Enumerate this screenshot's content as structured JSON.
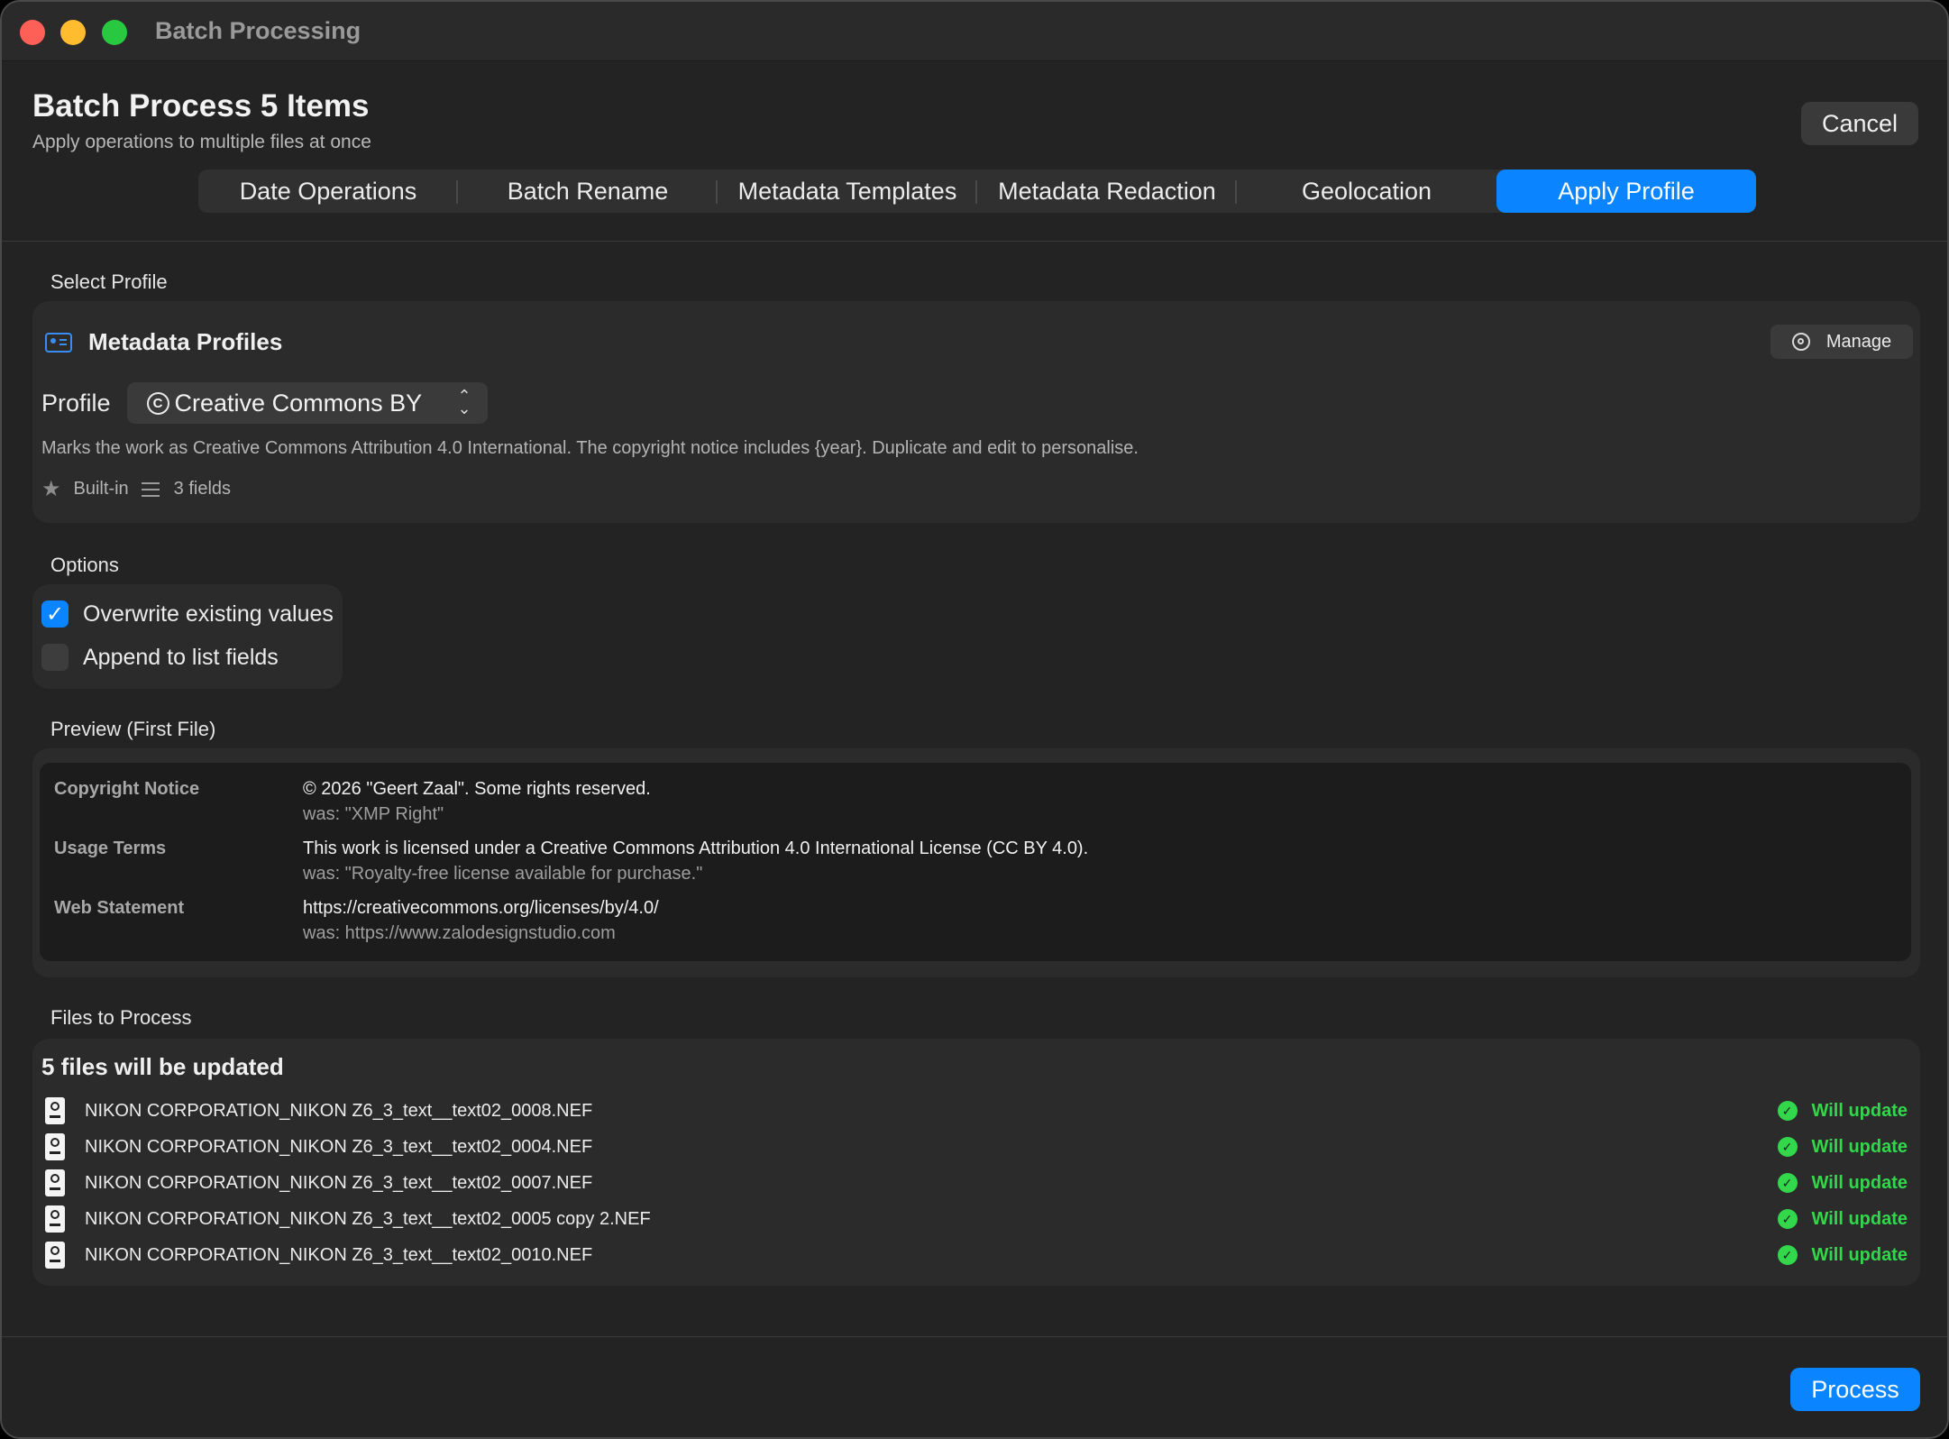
{
  "window": {
    "title": "Batch Processing"
  },
  "header": {
    "title": "Batch Process 5 Items",
    "subtitle": "Apply operations to multiple files at once",
    "cancel_label": "Cancel"
  },
  "tabs": [
    {
      "label": "Date Operations",
      "active": false
    },
    {
      "label": "Batch Rename",
      "active": false
    },
    {
      "label": "Metadata Templates",
      "active": false
    },
    {
      "label": "Metadata Redaction",
      "active": false
    },
    {
      "label": "Geolocation",
      "active": false
    },
    {
      "label": "Apply Profile",
      "active": true
    }
  ],
  "select_profile": {
    "section_label": "Select Profile",
    "card_title": "Metadata Profiles",
    "manage_label": "Manage",
    "profile_label": "Profile",
    "selected_profile": "Creative Commons BY",
    "cc_symbol": "C",
    "description": "Marks the work as Creative Commons Attribution 4.0 International. The copyright notice includes {year}. Duplicate and edit to personalise.",
    "badge_builtin": "Built-in",
    "fields_count": "3 fields"
  },
  "options": {
    "section_label": "Options",
    "items": [
      {
        "label": "Overwrite existing values",
        "checked": true
      },
      {
        "label": "Append to list fields",
        "checked": false
      }
    ]
  },
  "preview": {
    "section_label": "Preview (First File)",
    "rows": [
      {
        "field": "Copyright Notice",
        "new_value": "© 2026 \"Geert Zaal\". Some rights reserved.",
        "old_value": "was: \"XMP Right\""
      },
      {
        "field": "Usage Terms",
        "new_value": "This work is licensed under a Creative Commons Attribution 4.0 International License (CC BY 4.0).",
        "old_value": "was: \"Royalty-free license available for purchase.\""
      },
      {
        "field": "Web Statement",
        "new_value": "https://creativecommons.org/licenses/by/4.0/",
        "old_value": "was: https://www.zalodesignstudio.com"
      }
    ]
  },
  "files": {
    "section_label": "Files to Process",
    "summary": "5 files will be updated",
    "items": [
      {
        "name": "NIKON CORPORATION_NIKON Z6_3_text__text02_0008.NEF",
        "status": "Will update"
      },
      {
        "name": "NIKON CORPORATION_NIKON Z6_3_text__text02_0004.NEF",
        "status": "Will update"
      },
      {
        "name": "NIKON CORPORATION_NIKON Z6_3_text__text02_0007.NEF",
        "status": "Will update"
      },
      {
        "name": "NIKON CORPORATION_NIKON Z6_3_text__text02_0005 copy 2.NEF",
        "status": "Will update"
      },
      {
        "name": "NIKON CORPORATION_NIKON Z6_3_text__text02_0010.NEF",
        "status": "Will update"
      }
    ]
  },
  "footer": {
    "process_label": "Process"
  },
  "colors": {
    "accent": "#0a84ff",
    "success": "#32d74b",
    "background": "#232323",
    "card": "#2b2b2b"
  }
}
